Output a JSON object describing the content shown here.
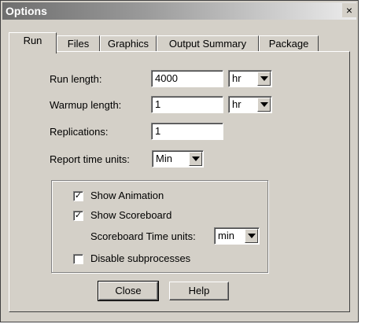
{
  "window": {
    "title": "Options",
    "close_glyph": "×"
  },
  "tabs": [
    {
      "label": "Run",
      "active": true
    },
    {
      "label": "Files",
      "active": false
    },
    {
      "label": "Graphics",
      "active": false
    },
    {
      "label": "Output Summary",
      "active": false
    },
    {
      "label": "Package",
      "active": false
    }
  ],
  "run": {
    "run_length": {
      "label": "Run length:",
      "value": "4000",
      "unit": "hr"
    },
    "warmup_length": {
      "label": "Warmup length:",
      "value": "1",
      "unit": "hr"
    },
    "replications": {
      "label": "Replications:",
      "value": "1"
    },
    "report_time_units": {
      "label": "Report time units:",
      "value": "Min"
    }
  },
  "options": {
    "show_animation": {
      "label": "Show Animation",
      "checked": true,
      "mark": "✓"
    },
    "show_scoreboard": {
      "label": "Show Scoreboard",
      "checked": true,
      "mark": "✓"
    },
    "scoreboard_time_units": {
      "label": "Scoreboard Time units:",
      "value": "min"
    },
    "disable_subprocesses": {
      "label": "Disable subprocesses",
      "checked": false,
      "mark": ""
    }
  },
  "buttons": {
    "close": "Close",
    "help": "Help"
  },
  "colors": {
    "face": "#d4d0c8",
    "title_dark": "#6e6e6e",
    "title_light": "#ececec"
  }
}
